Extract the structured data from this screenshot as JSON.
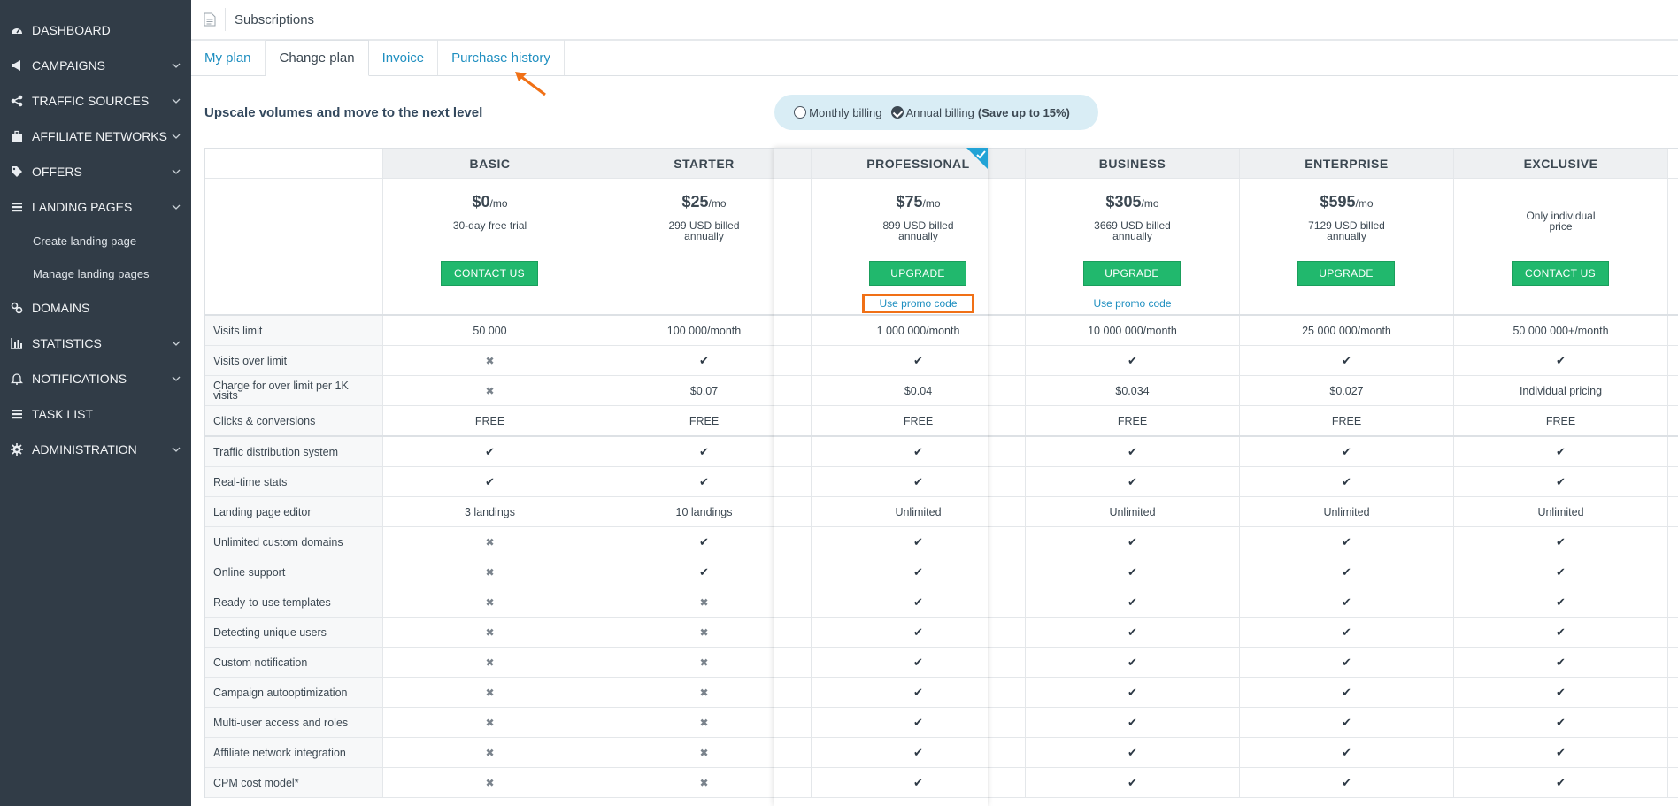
{
  "sidebar": {
    "items": [
      {
        "label": "DASHBOARD",
        "icon": "dashboard-icon",
        "chevron": false
      },
      {
        "label": "CAMPAIGNS",
        "icon": "megaphone-icon",
        "chevron": true
      },
      {
        "label": "TRAFFIC SOURCES",
        "icon": "share-icon",
        "chevron": true
      },
      {
        "label": "AFFILIATE NETWORKS",
        "icon": "briefcase-icon",
        "chevron": true
      },
      {
        "label": "OFFERS",
        "icon": "tags-icon",
        "chevron": true
      },
      {
        "label": "LANDING PAGES",
        "icon": "list-icon",
        "chevron": true
      }
    ],
    "subitems": [
      "Create landing page",
      "Manage landing pages"
    ],
    "items2": [
      {
        "label": "DOMAINS",
        "icon": "link-icon",
        "chevron": false
      },
      {
        "label": "STATISTICS",
        "icon": "bar-chart-icon",
        "chevron": true
      },
      {
        "label": "NOTIFICATIONS",
        "icon": "bell-icon",
        "chevron": true
      },
      {
        "label": "TASK LIST",
        "icon": "list-icon",
        "chevron": false
      },
      {
        "label": "ADMINISTRATION",
        "icon": "gear-icon",
        "chevron": true
      }
    ]
  },
  "header": {
    "title": "Subscriptions"
  },
  "tabs": [
    "My plan",
    "Change plan",
    "Invoice",
    "Purchase history"
  ],
  "active_tab": "Change plan",
  "headline": "Upscale volumes and move to the next level",
  "billing": {
    "monthly": "Monthly billing",
    "annual": "Annual billing",
    "save": "(Save up to 15%)",
    "selected": "annual"
  },
  "plans": [
    {
      "name": "BASIC",
      "price": "$0",
      "per": "/mo",
      "note": "30-day free trial",
      "button": "CONTACT US",
      "promo": ""
    },
    {
      "name": "STARTER",
      "price": "$25",
      "per": "/mo",
      "note": "299 USD billed annually",
      "button": "",
      "promo": ""
    },
    {
      "name": "PROFESSIONAL",
      "price": "$75",
      "per": "/mo",
      "note": "899 USD billed annually",
      "button": "UPGRADE",
      "promo": "Use promo code"
    },
    {
      "name": "BUSINESS",
      "price": "$305",
      "per": "/mo",
      "note": "3669 USD billed annually",
      "button": "UPGRADE",
      "promo": "Use promo code"
    },
    {
      "name": "ENTERPRISE",
      "price": "$595",
      "per": "/mo",
      "note": "7129 USD billed annually",
      "button": "UPGRADE",
      "promo": ""
    },
    {
      "name": "EXCLUSIVE",
      "price": "",
      "per": "",
      "note": "Only individual price",
      "button": "CONTACT US",
      "promo": ""
    }
  ],
  "features_group1": [
    {
      "label": "Visits limit",
      "values": [
        "50 000",
        "100 000/month",
        "1 000 000/month",
        "10 000 000/month",
        "25 000 000/month",
        "50 000 000+/month"
      ]
    },
    {
      "label": "Visits over limit",
      "values": [
        "x",
        "v",
        "v",
        "v",
        "v",
        "v"
      ]
    },
    {
      "label": "Charge for over limit per 1K visits",
      "values": [
        "x",
        "$0.07",
        "$0.04",
        "$0.034",
        "$0.027",
        "Individual pricing"
      ]
    },
    {
      "label": "Clicks & conversions",
      "values": [
        "FREE",
        "FREE",
        "FREE",
        "FREE",
        "FREE",
        "FREE"
      ]
    }
  ],
  "features_group2": [
    {
      "label": "Traffic distribution system",
      "values": [
        "v",
        "v",
        "v",
        "v",
        "v",
        "v"
      ]
    },
    {
      "label": "Real-time stats",
      "values": [
        "v",
        "v",
        "v",
        "v",
        "v",
        "v"
      ]
    },
    {
      "label": "Landing page editor",
      "values": [
        "3 landings",
        "10 landings",
        "Unlimited",
        "Unlimited",
        "Unlimited",
        "Unlimited"
      ]
    },
    {
      "label": "Unlimited custom domains",
      "values": [
        "x",
        "v",
        "v",
        "v",
        "v",
        "v"
      ]
    },
    {
      "label": "Online support",
      "values": [
        "x",
        "v",
        "v",
        "v",
        "v",
        "v"
      ]
    },
    {
      "label": "Ready-to-use templates",
      "values": [
        "x",
        "x",
        "v",
        "v",
        "v",
        "v"
      ]
    },
    {
      "label": "Detecting unique users",
      "values": [
        "x",
        "x",
        "v",
        "v",
        "v",
        "v"
      ]
    },
    {
      "label": "Custom notification",
      "values": [
        "x",
        "x",
        "v",
        "v",
        "v",
        "v"
      ]
    },
    {
      "label": "Campaign autooptimization",
      "values": [
        "x",
        "x",
        "v",
        "v",
        "v",
        "v"
      ]
    },
    {
      "label": "Multi-user access and roles",
      "values": [
        "x",
        "x",
        "v",
        "v",
        "v",
        "v"
      ]
    },
    {
      "label": "Affiliate network integration",
      "values": [
        "x",
        "x",
        "v",
        "v",
        "v",
        "v"
      ]
    },
    {
      "label": "CPM cost model*",
      "values": [
        "x",
        "x",
        "v",
        "v",
        "v",
        "v"
      ]
    }
  ],
  "colors": {
    "sidebar": "#313c47",
    "accent": "#21b86d",
    "link": "#1f8fc0",
    "highlight": "#f07016"
  }
}
